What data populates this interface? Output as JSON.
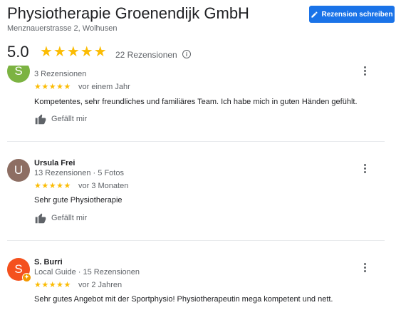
{
  "business": {
    "name": "Physiotherapie Groenendijk GmbH",
    "address": "Menznauerstrasse 2, Wolhusen",
    "rating": "5.0",
    "stars": "★★★★★",
    "review_count_label": "22 Rezensionen",
    "info_glyph": "i"
  },
  "write_review_label": "Rezension schreiben",
  "reviews": [
    {
      "avatar_letter": "S",
      "avatar_color": "#7cb342",
      "meta": "3 Rezensionen",
      "stars": "★★★★★",
      "when": "vor einem Jahr",
      "text": "Kompetentes,  sehr freundliches und familiäres Team. Ich habe mich in guten Händen gefühlt.",
      "like_label": "Gefällt mir"
    },
    {
      "avatar_letter": "U",
      "avatar_color": "#8d6e63",
      "name": "Ursula Frei",
      "meta": "13 Rezensionen · 5 Fotos",
      "stars": "★★★★★",
      "when": "vor 3 Monaten",
      "text": "Sehr gute Physiotherapie",
      "like_label": "Gefällt mir"
    },
    {
      "avatar_letter": "S",
      "avatar_color": "#f4511e",
      "name": "S. Burri",
      "meta": "Local Guide · 15 Rezensionen",
      "stars": "★★★★★",
      "when": "vor 2 Jahren",
      "text": "Sehr gutes Angebot mit der Sportphysio! Physiotherapeutin mega kompetent und nett.",
      "badge": "✦"
    }
  ],
  "colors": {
    "accent": "#1a73e8",
    "star": "#fbbc04",
    "secondary_text": "#5f6368"
  }
}
